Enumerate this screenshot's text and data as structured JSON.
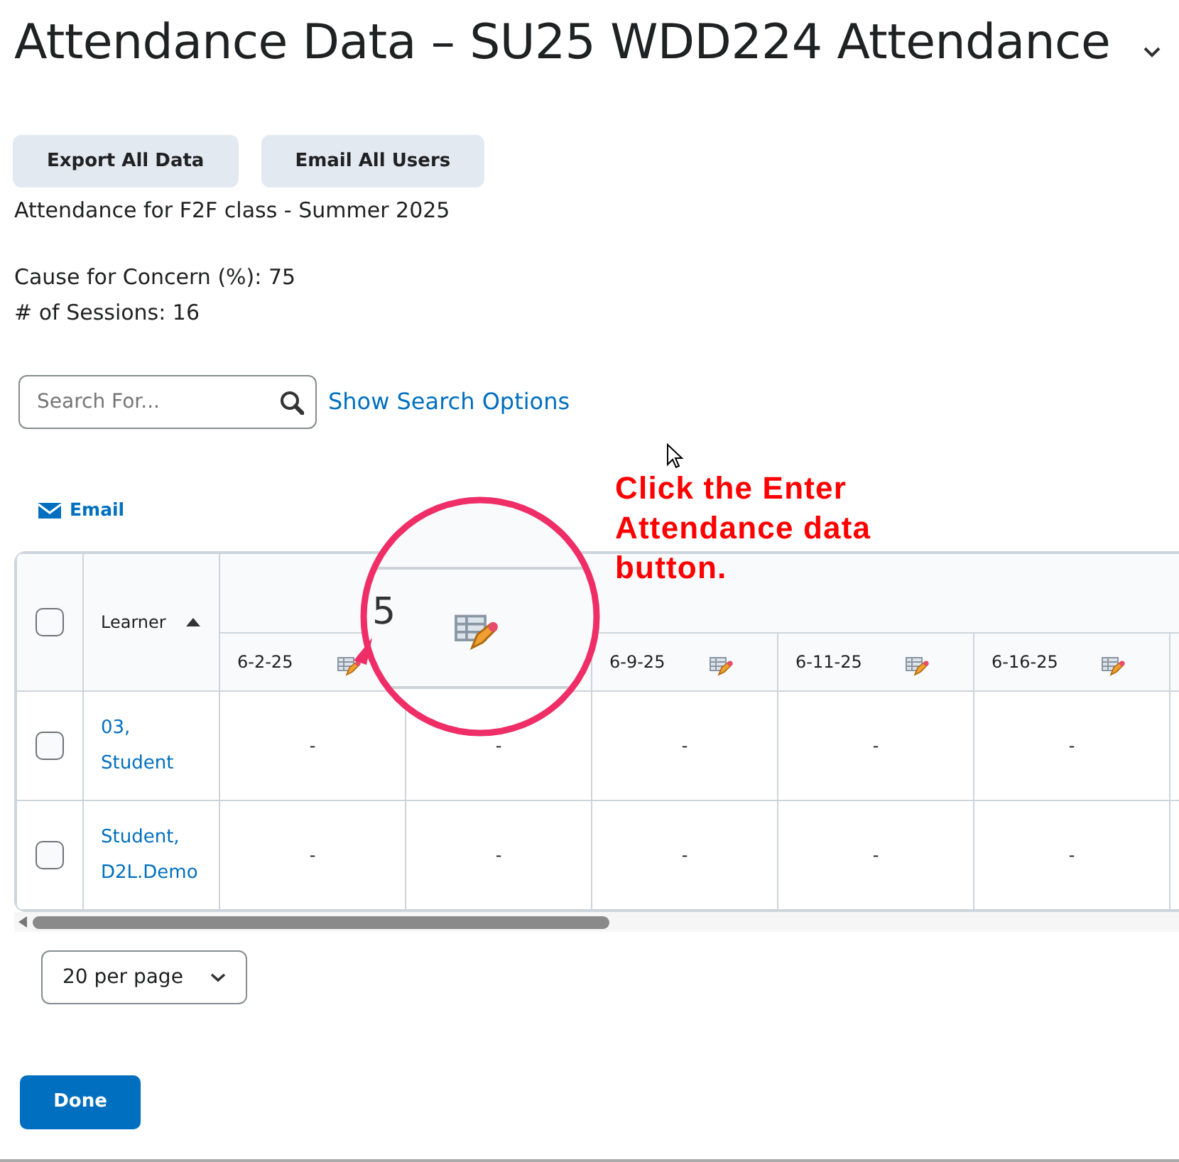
{
  "page": {
    "title": "Attendance Data – SU25 WDD224 Attendance"
  },
  "buttons": [
    "Export All Data",
    "Email All Users"
  ],
  "description": "Attendance for F2F class - Summer 2025",
  "stats": [
    "Cause for Concern (%): 75",
    "# of Sessions: 16"
  ],
  "search": {
    "placeholder": "Search For...",
    "options_link": "Show Search Options"
  },
  "email_action": "Email",
  "table": {
    "select_all": {
      "checked": false
    },
    "learner_column": {
      "label": "Learner",
      "sort_ascending": true
    },
    "sessions": [
      {
        "kind": "labeled",
        "label": "6-2-25"
      },
      {
        "kind": "covered"
      },
      {
        "kind": "labeled",
        "label": "6-9-25"
      },
      {
        "kind": "labeled",
        "label": "6-11-25"
      },
      {
        "kind": "labeled",
        "label": "6-16-25"
      },
      {
        "kind": "cut"
      }
    ],
    "rows": [
      {
        "checked": false,
        "learner": "03, Student",
        "cells": [
          "-",
          "-",
          "-",
          "-",
          "-",
          ""
        ]
      },
      {
        "checked": false,
        "learner": "Student, D2L.Demo",
        "cells": [
          "-",
          "-",
          "-",
          "-",
          "-",
          ""
        ]
      }
    ]
  },
  "pagination": {
    "per_page": "20 per page"
  },
  "done_button": "Done",
  "annotation": {
    "text": "Click the Enter Attendance data button.",
    "magnified_text": "5"
  }
}
